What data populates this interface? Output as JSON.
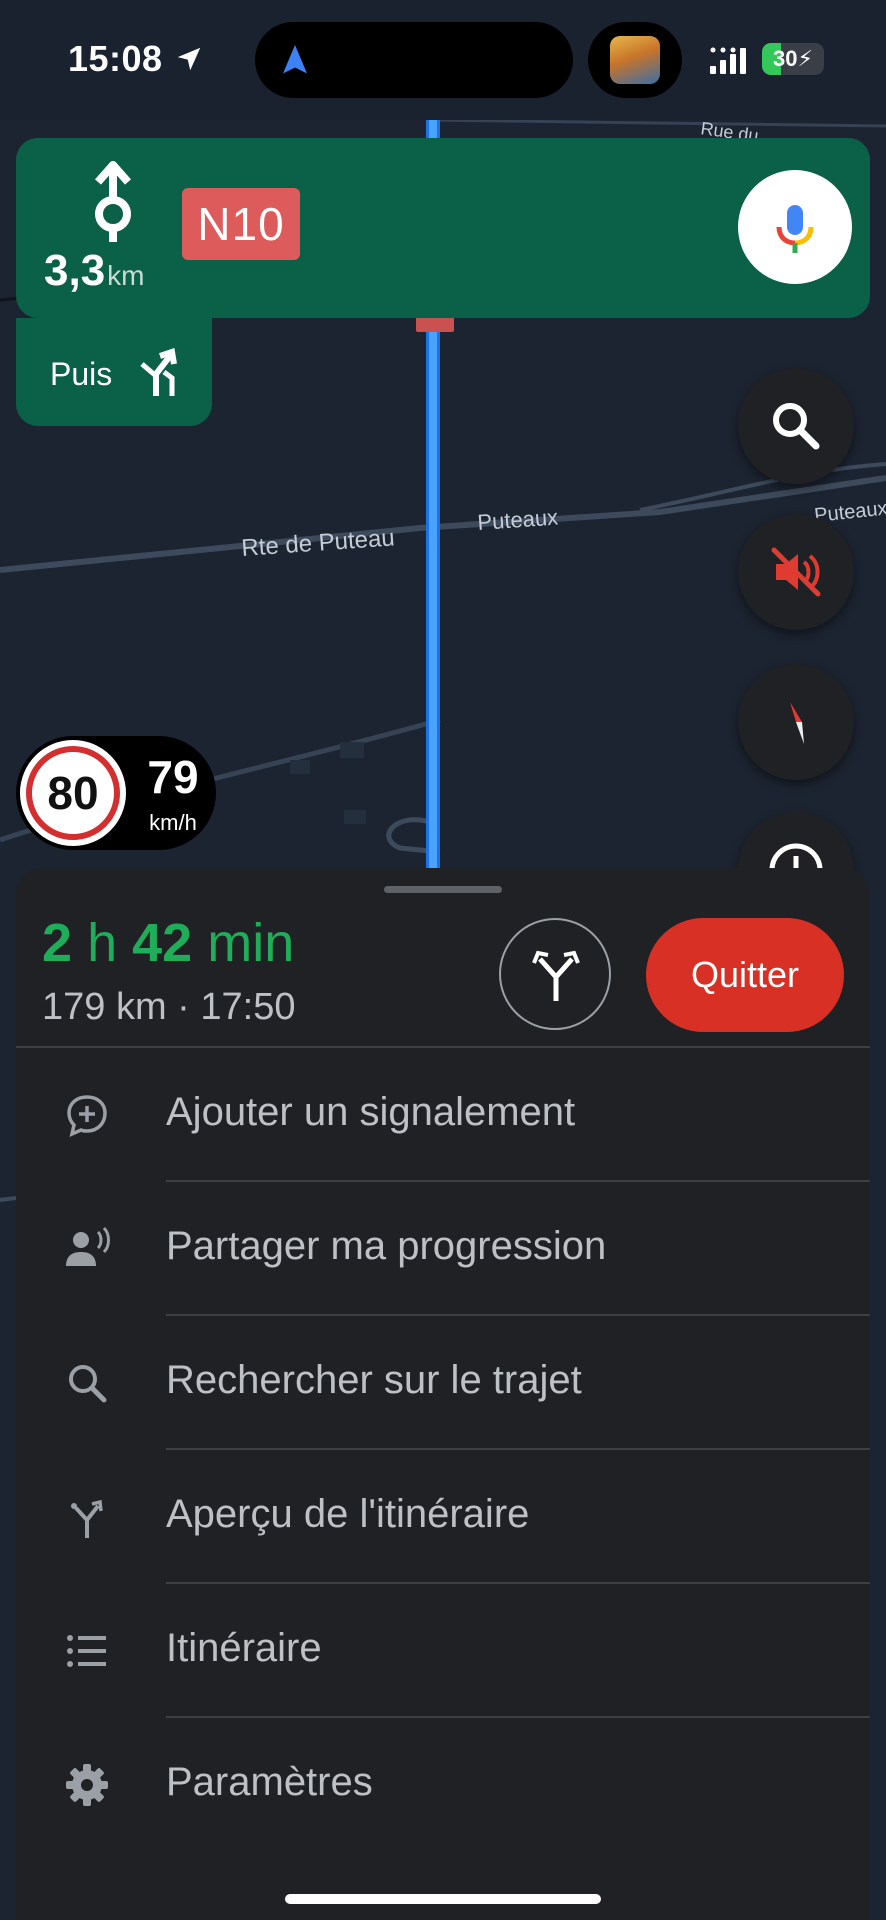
{
  "status_bar": {
    "time": "15:08",
    "battery_level": 30,
    "battery_text": "30",
    "battery_color": "#34c759"
  },
  "map": {
    "street_labels": [
      "Rte de Puteau",
      "Puteaux",
      "Puteaux",
      "Rue du"
    ],
    "route_color": "#1a73e8"
  },
  "navigation": {
    "turn_icon": "roundabout-straight-icon",
    "distance_value": "3,3",
    "distance_unit": "km",
    "road_sign": "N10",
    "road_sign_color": "#dd5b5b",
    "banner_color": "#0b6148",
    "then_label": "Puis",
    "then_icon": "keep-right-icon",
    "voice_button_icon": "mic-icon"
  },
  "map_controls": [
    "search-icon",
    "sound-muted-icon",
    "compass-icon",
    "report-icon"
  ],
  "speed": {
    "limit": "80",
    "current": "79",
    "unit": "km/h"
  },
  "trip": {
    "eta_hours": "2",
    "eta_hours_unit": "h",
    "eta_minutes": "42",
    "eta_minutes_unit": "min",
    "summary": "179 km · 17:50",
    "eta_color": "#1fad5a",
    "alternate_routes_icon": "fork-route-icon",
    "quit_label": "Quitter",
    "quit_color": "#d93025"
  },
  "menu": [
    {
      "label": "Ajouter un signalement",
      "icon": "add-report-icon"
    },
    {
      "label": "Partager ma progression",
      "icon": "share-progress-icon"
    },
    {
      "label": "Rechercher sur le trajet",
      "icon": "search-icon"
    },
    {
      "label": "Aperçu de l'itinéraire",
      "icon": "route-overview-icon"
    },
    {
      "label": "Itinéraire",
      "icon": "list-icon"
    },
    {
      "label": "Paramètres",
      "icon": "gear-icon"
    }
  ]
}
